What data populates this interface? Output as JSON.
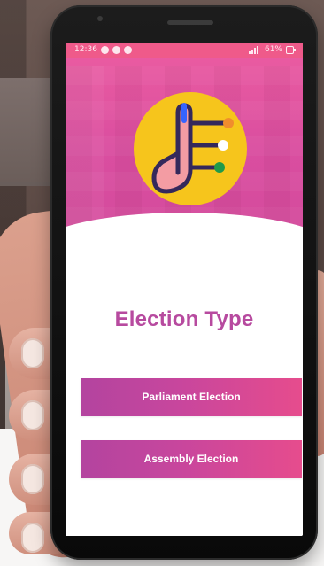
{
  "status_bar": {
    "time": "12:36",
    "battery": "61%"
  },
  "screen": {
    "title": "Election Type",
    "options": [
      {
        "label": "Parliament Election"
      },
      {
        "label": "Assembly Election"
      }
    ]
  },
  "colors": {
    "header_pink": "#e0559f",
    "title_purple": "#b74a9f",
    "button_start": "#b3449f",
    "button_end": "#e64c8d",
    "logo_yellow": "#f6c51c"
  },
  "icons": {
    "logo": "election-ink-finger-logo",
    "signal": "signal-icon",
    "battery": "battery-icon"
  }
}
